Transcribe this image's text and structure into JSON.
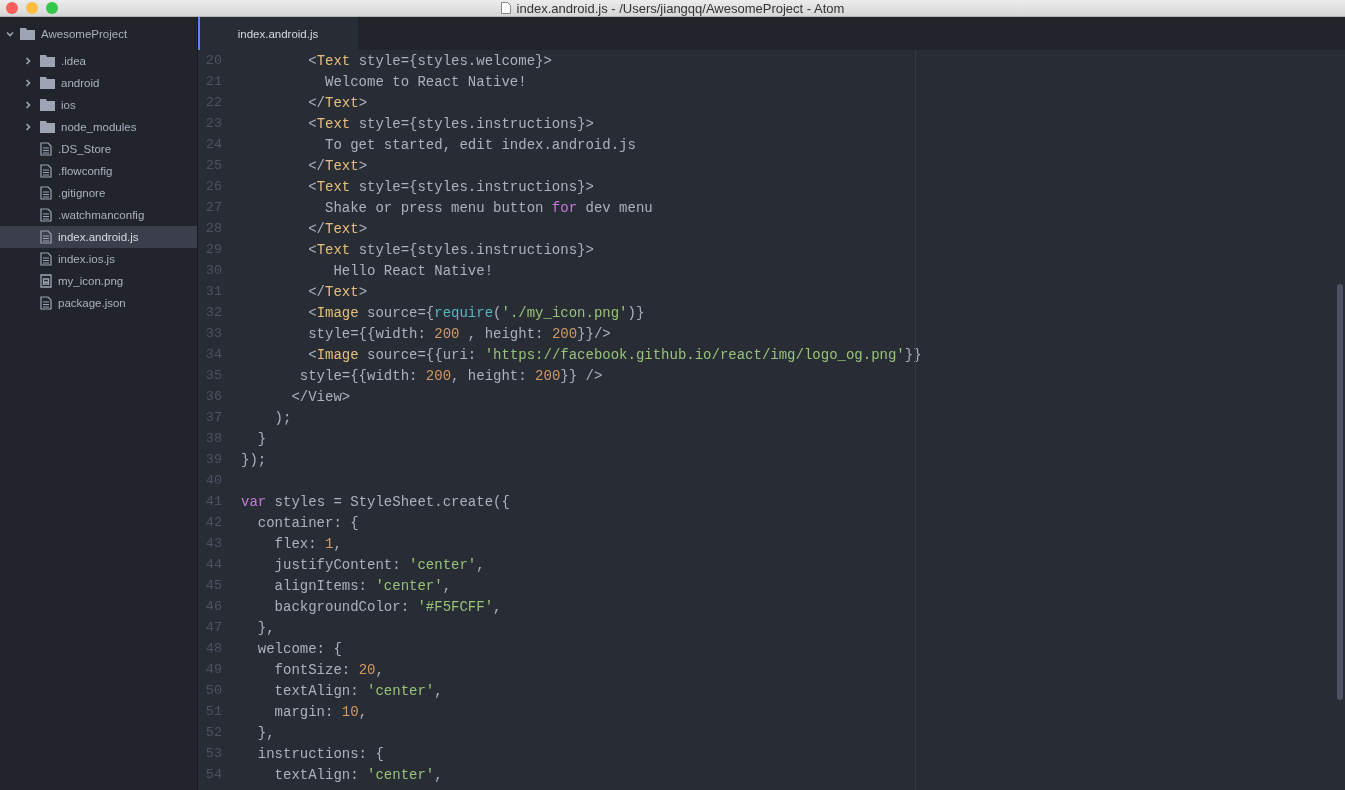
{
  "window": {
    "title": "index.android.js - /Users/jiangqq/AwesomeProject - Atom"
  },
  "tree": {
    "label": "AwesomeProject",
    "expanded": true,
    "children": [
      {
        "kind": "folder",
        "label": ".idea",
        "expanded": false,
        "selected": false
      },
      {
        "kind": "folder",
        "label": "android",
        "expanded": false,
        "selected": false
      },
      {
        "kind": "folder",
        "label": "ios",
        "expanded": false,
        "selected": false
      },
      {
        "kind": "folder",
        "label": "node_modules",
        "expanded": false,
        "selected": false
      },
      {
        "kind": "file",
        "label": ".DS_Store",
        "selected": false
      },
      {
        "kind": "file",
        "label": ".flowconfig",
        "selected": false
      },
      {
        "kind": "file",
        "label": ".gitignore",
        "selected": false
      },
      {
        "kind": "file",
        "label": ".watchmanconfig",
        "selected": false
      },
      {
        "kind": "file",
        "label": "index.android.js",
        "selected": true
      },
      {
        "kind": "file",
        "label": "index.ios.js",
        "selected": false
      },
      {
        "kind": "image",
        "label": "my_icon.png",
        "selected": false
      },
      {
        "kind": "file",
        "label": "package.json",
        "selected": false
      }
    ]
  },
  "tabs": [
    {
      "label": "index.android.js",
      "selected": true
    }
  ],
  "lines": [
    {
      "number": "20",
      "tokens": [
        {
          "kind": "plain",
          "text": "        <"
        },
        {
          "kind": "tag",
          "text": "Text"
        },
        {
          "kind": "plain",
          "text": " style={styles.welcome}>"
        }
      ]
    },
    {
      "number": "21",
      "tokens": [
        {
          "kind": "plain",
          "text": "          Welcome to React Native!"
        }
      ]
    },
    {
      "number": "22",
      "tokens": [
        {
          "kind": "plain",
          "text": "        </"
        },
        {
          "kind": "tag",
          "text": "Text"
        },
        {
          "kind": "plain",
          "text": ">"
        }
      ]
    },
    {
      "number": "23",
      "tokens": [
        {
          "kind": "plain",
          "text": "        <"
        },
        {
          "kind": "tag",
          "text": "Text"
        },
        {
          "kind": "plain",
          "text": " style={styles.instructions}>"
        }
      ]
    },
    {
      "number": "24",
      "tokens": [
        {
          "kind": "plain",
          "text": "          To get started, edit index.android.js"
        }
      ]
    },
    {
      "number": "25",
      "tokens": [
        {
          "kind": "plain",
          "text": "        </"
        },
        {
          "kind": "tag",
          "text": "Text"
        },
        {
          "kind": "plain",
          "text": ">"
        }
      ]
    },
    {
      "number": "26",
      "tokens": [
        {
          "kind": "plain",
          "text": "        <"
        },
        {
          "kind": "tag",
          "text": "Text"
        },
        {
          "kind": "plain",
          "text": " style={styles.instructions}>"
        }
      ]
    },
    {
      "number": "27",
      "tokens": [
        {
          "kind": "plain",
          "text": "          Shake or press menu button "
        },
        {
          "kind": "keyword",
          "text": "for"
        },
        {
          "kind": "plain",
          "text": " dev menu"
        }
      ]
    },
    {
      "number": "28",
      "tokens": [
        {
          "kind": "plain",
          "text": "        </"
        },
        {
          "kind": "tag",
          "text": "Text"
        },
        {
          "kind": "plain",
          "text": ">"
        }
      ]
    },
    {
      "number": "29",
      "tokens": [
        {
          "kind": "plain",
          "text": "        <"
        },
        {
          "kind": "tag",
          "text": "Text"
        },
        {
          "kind": "plain",
          "text": " style={styles.instructions}>"
        }
      ]
    },
    {
      "number": "30",
      "tokens": [
        {
          "kind": "plain",
          "text": "           Hello React Native!"
        }
      ]
    },
    {
      "number": "31",
      "tokens": [
        {
          "kind": "plain",
          "text": "        </"
        },
        {
          "kind": "tag",
          "text": "Text"
        },
        {
          "kind": "plain",
          "text": ">"
        }
      ]
    },
    {
      "number": "32",
      "tokens": [
        {
          "kind": "plain",
          "text": "        <"
        },
        {
          "kind": "tag",
          "text": "Image"
        },
        {
          "kind": "plain",
          "text": " source={"
        },
        {
          "kind": "function",
          "text": "require"
        },
        {
          "kind": "plain",
          "text": "("
        },
        {
          "kind": "string",
          "text": "'./my_icon.png'"
        },
        {
          "kind": "plain",
          "text": ")}"
        }
      ]
    },
    {
      "number": "33",
      "tokens": [
        {
          "kind": "plain",
          "text": "        style={{width: "
        },
        {
          "kind": "number",
          "text": "200"
        },
        {
          "kind": "plain",
          "text": " , height: "
        },
        {
          "kind": "number",
          "text": "200"
        },
        {
          "kind": "plain",
          "text": "}}/>"
        }
      ]
    },
    {
      "number": "34",
      "tokens": [
        {
          "kind": "plain",
          "text": "        <"
        },
        {
          "kind": "tag",
          "text": "Image"
        },
        {
          "kind": "plain",
          "text": " source={{uri: "
        },
        {
          "kind": "string",
          "text": "'https://facebook.github.io/react/img/logo_og.png'"
        },
        {
          "kind": "plain",
          "text": "}}"
        }
      ]
    },
    {
      "number": "35",
      "tokens": [
        {
          "kind": "plain",
          "text": "       style={{width: "
        },
        {
          "kind": "number",
          "text": "200"
        },
        {
          "kind": "plain",
          "text": ", height: "
        },
        {
          "kind": "number",
          "text": "200"
        },
        {
          "kind": "plain",
          "text": "}} />"
        }
      ]
    },
    {
      "number": "36",
      "tokens": [
        {
          "kind": "plain",
          "text": "      </View>"
        }
      ]
    },
    {
      "number": "37",
      "tokens": [
        {
          "kind": "plain",
          "text": "    );"
        }
      ]
    },
    {
      "number": "38",
      "tokens": [
        {
          "kind": "plain",
          "text": "  }"
        }
      ]
    },
    {
      "number": "39",
      "tokens": [
        {
          "kind": "plain",
          "text": "});"
        }
      ]
    },
    {
      "number": "40"
    },
    {
      "number": "41",
      "tokens": [
        {
          "kind": "keyword",
          "text": "var"
        },
        {
          "kind": "plain",
          "text": " styles = StyleSheet.create({"
        }
      ]
    },
    {
      "number": "42",
      "tokens": [
        {
          "kind": "plain",
          "text": "  container: {"
        }
      ]
    },
    {
      "number": "43",
      "tokens": [
        {
          "kind": "plain",
          "text": "    flex: "
        },
        {
          "kind": "number",
          "text": "1"
        },
        {
          "kind": "plain",
          "text": ","
        }
      ]
    },
    {
      "number": "44",
      "tokens": [
        {
          "kind": "plain",
          "text": "    justifyContent: "
        },
        {
          "kind": "string",
          "text": "'center'"
        },
        {
          "kind": "plain",
          "text": ","
        }
      ]
    },
    {
      "number": "45",
      "tokens": [
        {
          "kind": "plain",
          "text": "    alignItems: "
        },
        {
          "kind": "string",
          "text": "'center'"
        },
        {
          "kind": "plain",
          "text": ","
        }
      ]
    },
    {
      "number": "46",
      "tokens": [
        {
          "kind": "plain",
          "text": "    backgroundColor: "
        },
        {
          "kind": "string",
          "text": "'#F5FCFF'"
        },
        {
          "kind": "plain",
          "text": ","
        }
      ]
    },
    {
      "number": "47",
      "tokens": [
        {
          "kind": "plain",
          "text": "  },"
        }
      ]
    },
    {
      "number": "48",
      "tokens": [
        {
          "kind": "plain",
          "text": "  welcome: {"
        }
      ]
    },
    {
      "number": "49",
      "tokens": [
        {
          "kind": "plain",
          "text": "    fontSize: "
        },
        {
          "kind": "number",
          "text": "20"
        },
        {
          "kind": "plain",
          "text": ","
        }
      ]
    },
    {
      "number": "50",
      "tokens": [
        {
          "kind": "plain",
          "text": "    textAlign: "
        },
        {
          "kind": "string",
          "text": "'center'"
        },
        {
          "kind": "plain",
          "text": ","
        }
      ]
    },
    {
      "number": "51",
      "tokens": [
        {
          "kind": "plain",
          "text": "    margin: "
        },
        {
          "kind": "number",
          "text": "10"
        },
        {
          "kind": "plain",
          "text": ","
        }
      ]
    },
    {
      "number": "52",
      "tokens": [
        {
          "kind": "plain",
          "text": "  },"
        }
      ]
    },
    {
      "number": "53",
      "tokens": [
        {
          "kind": "plain",
          "text": "  instructions: {"
        }
      ]
    },
    {
      "number": "54",
      "tokens": [
        {
          "kind": "plain",
          "text": "    textAlign: "
        },
        {
          "kind": "string",
          "text": "'center'"
        },
        {
          "kind": "plain",
          "text": ","
        }
      ]
    }
  ]
}
